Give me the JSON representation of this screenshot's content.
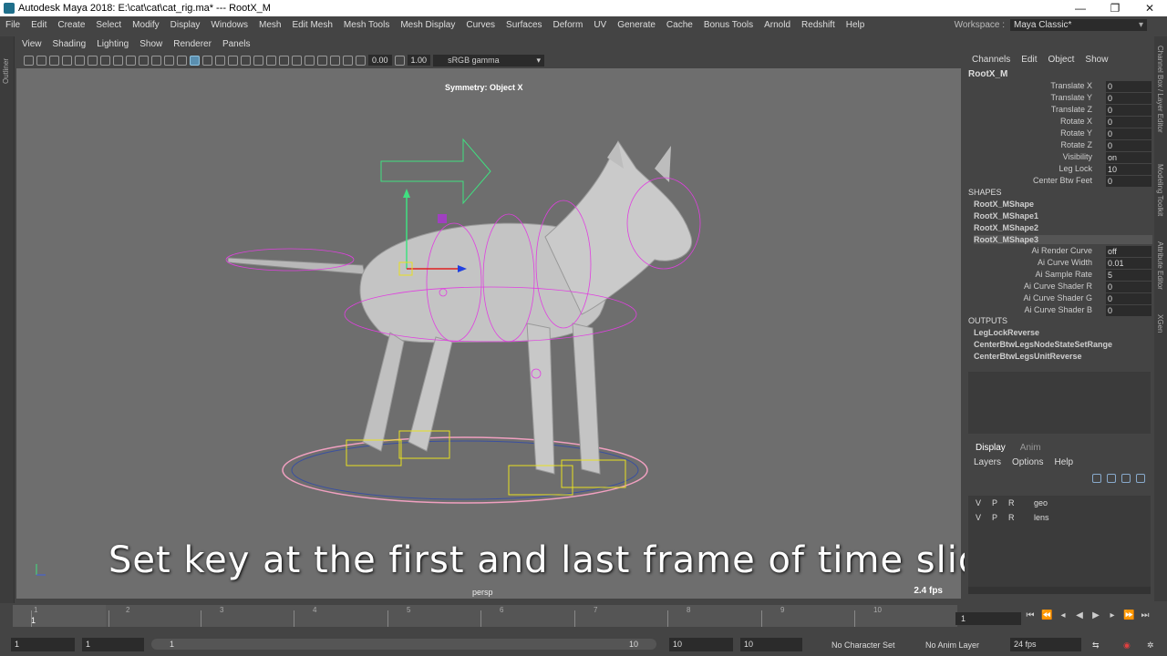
{
  "window": {
    "title": "Autodesk Maya 2018: E:\\cat\\cat\\cat_rig.ma*   ---   RootX_M",
    "minimize": "—",
    "maximize": "❐",
    "close": "✕"
  },
  "menubar": {
    "items": [
      "File",
      "Edit",
      "Create",
      "Select",
      "Modify",
      "Display",
      "Windows",
      "Mesh",
      "Edit Mesh",
      "Mesh Tools",
      "Mesh Display",
      "Curves",
      "Surfaces",
      "Deform",
      "UV",
      "Generate",
      "Cache",
      "Bonus Tools",
      "Arnold",
      "Redshift",
      "Help"
    ],
    "workspace_label": "Workspace :",
    "workspace_value": "Maya Classic*"
  },
  "outliner_tab": "Outliner",
  "viewport": {
    "menu": [
      "View",
      "Shading",
      "Lighting",
      "Show",
      "Renderer",
      "Panels"
    ],
    "field1": "0.00",
    "field2": "1.00",
    "color_space": "sRGB gamma",
    "symmetry": "Symmetry: Object X",
    "camera": "persp",
    "fps": "2.4 fps",
    "subtitle": "Set key at the first and last frame of time slider"
  },
  "channel_box": {
    "menu": [
      "Channels",
      "Edit",
      "Object",
      "Show"
    ],
    "node": "RootX_M",
    "channels": [
      {
        "label": "Translate X",
        "value": "0"
      },
      {
        "label": "Translate Y",
        "value": "0"
      },
      {
        "label": "Translate Z",
        "value": "0"
      },
      {
        "label": "Rotate X",
        "value": "0"
      },
      {
        "label": "Rotate Y",
        "value": "0"
      },
      {
        "label": "Rotate Z",
        "value": "0"
      },
      {
        "label": "Visibility",
        "value": "on"
      },
      {
        "label": "Leg Lock",
        "value": "10"
      },
      {
        "label": "Center Btw Feet",
        "value": "0"
      }
    ],
    "shapes_header": "SHAPES",
    "shapes": [
      "RootX_MShape",
      "RootX_MShape1",
      "RootX_MShape2",
      "RootX_MShape3"
    ],
    "shape_attrs": [
      {
        "label": "Ai Render Curve",
        "value": "off"
      },
      {
        "label": "Ai Curve Width",
        "value": "0.01"
      },
      {
        "label": "Ai Sample Rate",
        "value": "5"
      },
      {
        "label": "Ai Curve Shader R",
        "value": "0"
      },
      {
        "label": "Ai Curve Shader G",
        "value": "0"
      },
      {
        "label": "Ai Curve Shader B",
        "value": "0"
      }
    ],
    "outputs_header": "OUTPUTS",
    "outputs": [
      "LegLockReverse",
      "CenterBtwLegsNodeStateSetRange",
      "CenterBtwLegsUnitReverse"
    ]
  },
  "layers": {
    "tabs": [
      "Display",
      "Anim"
    ],
    "menu": [
      "Layers",
      "Options",
      "Help"
    ],
    "rows": [
      {
        "v": "V",
        "p": "P",
        "r": "R",
        "name": "geo"
      },
      {
        "v": "V",
        "p": "P",
        "r": "R",
        "name": "lens"
      }
    ]
  },
  "right_tabs": [
    "Channel Box / Layer Editor",
    "Modeling Toolkit",
    "Attribute Editor",
    "XGen"
  ],
  "timeline": {
    "ticks": [
      "1",
      "2",
      "3",
      "4",
      "5",
      "6",
      "7",
      "8",
      "9",
      "10"
    ],
    "current": "1",
    "current_frame_field": "1"
  },
  "range": {
    "start": "1",
    "anim_start": "1",
    "slider_left": "1",
    "slider_right": "10",
    "anim_end": "10",
    "end": "10",
    "character_set": "No Character Set",
    "anim_layer": "No Anim Layer",
    "fps": "24 fps"
  },
  "colors": {
    "rig_magenta": "#e040e0",
    "rig_yellow": "#e8e020",
    "gizmo_green": "#40e080",
    "viewport_bg": "#6e6e6e"
  }
}
